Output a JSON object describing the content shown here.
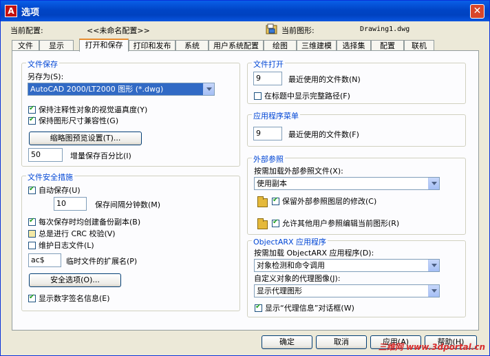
{
  "window": {
    "title": "选项",
    "close": "✕"
  },
  "header": {
    "profile_label": "当前配置:",
    "profile_value": "<<未命名配置>>",
    "drawing_label": "当前图形:",
    "drawing_value": "Drawing1.dwg"
  },
  "tabs": [
    "文件",
    "显示",
    "打开和保存",
    "打印和发布",
    "系统",
    "用户系统配置",
    "绘图",
    "三维建模",
    "选择集",
    "配置",
    "联机"
  ],
  "active_tab": "打开和保存",
  "file_save": {
    "title": "文件保存",
    "save_as_label": "另存为(S):",
    "save_as_value": "AutoCAD 2000/LT2000 图形 (*.dwg)",
    "keep_visual_fidelity": "保持注释性对象的视觉逼真度(Y)",
    "keep_dim_compat": "保持图形尺寸兼容性(G)",
    "thumbnail_button": "缩略图预览设置(T)...",
    "incremental_value": "50",
    "incremental_label": "增量保存百分比(I)"
  },
  "file_safety": {
    "title": "文件安全措施",
    "autosave": "自动保存(U)",
    "minutes_value": "10",
    "minutes_label": "保存间隔分钟数(M)",
    "backup_copy": "每次保存时均创建备份副本(B)",
    "crc_check": "总是进行 CRC 校验(V)",
    "log_file": "维护日志文件(L)",
    "temp_ext_value": "ac$",
    "temp_ext_label": "临时文件的扩展名(P)",
    "security_button": "安全选项(O)...",
    "digital_signature": "显示数字签名信息(E)"
  },
  "file_open": {
    "title": "文件打开",
    "recent_value": "9",
    "recent_label": "最近使用的文件数(N)",
    "full_path": "在标题中显示完整路径(F)"
  },
  "app_menu": {
    "title": "应用程序菜单",
    "recent_value": "9",
    "recent_label": "最近使用的文件数(F)"
  },
  "xref": {
    "title": "外部参照",
    "demand_load_label": "按需加载外部参照文件(X):",
    "demand_load_value": "使用副本",
    "retain_changes": "保留外部参照图层的修改(C)",
    "allow_edit": "允许其他用户参照编辑当前图形(R)"
  },
  "objectarx": {
    "title": "ObjectARX 应用程序",
    "demand_load_label": "按需加载 ObjectARX 应用程序(D):",
    "demand_load_value": "对象检测和命令调用",
    "proxy_images_label": "自定义对象的代理图像(J):",
    "proxy_images_value": "显示代理图形",
    "proxy_info": "显示“代理信息”对话框(W)"
  },
  "buttons": {
    "ok": "确定",
    "cancel": "取消",
    "apply": "应用(A)",
    "help": "帮助(H)"
  },
  "watermark": "三维网 www.3dportal.cn"
}
